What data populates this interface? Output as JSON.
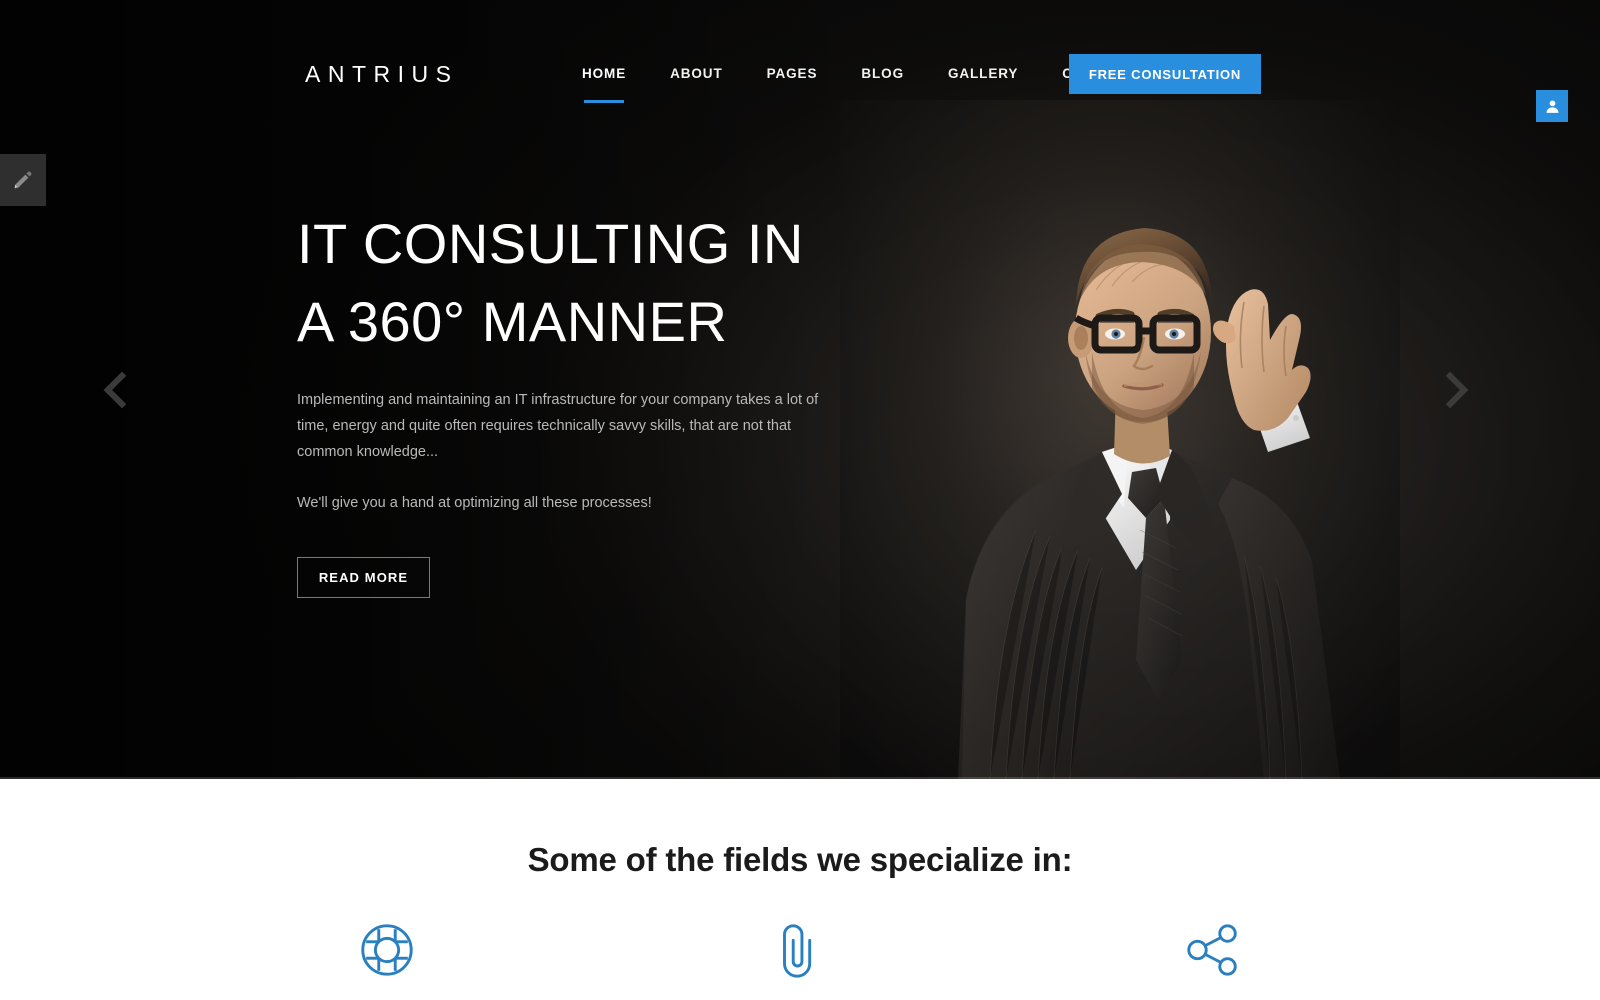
{
  "brand": {
    "name": "ANTRIUS",
    "accent_color": "#2a8ede"
  },
  "header": {
    "nav": [
      {
        "label": "HOME",
        "active": true
      },
      {
        "label": "ABOUT",
        "active": false
      },
      {
        "label": "PAGES",
        "active": false
      },
      {
        "label": "BLOG",
        "active": false
      },
      {
        "label": "GALLERY",
        "active": false
      },
      {
        "label": "CONTACTS",
        "active": false
      }
    ],
    "cta_label": "FREE CONSULTATION"
  },
  "hero": {
    "title": "IT CONSULTING IN\nA 360° MANNER",
    "description": "Implementing and maintaining an IT infrastructure for your company takes a lot of time, energy and quite often requires technically savvy skills, that are not that common knowledge...",
    "subtext": "We'll give you a hand at optimizing all these processes!",
    "button_label": "READ MORE",
    "prev_icon": "chevron-left-icon",
    "next_icon": "chevron-right-icon",
    "photo_alt": "businessman-in-suit-adjusting-glasses"
  },
  "side_tabs": {
    "edit_icon": "pencil-icon",
    "account_icon": "user-icon"
  },
  "specialize": {
    "title": "Some of the fields we specialize in:",
    "features": [
      {
        "icon": "lifebuoy-icon",
        "color": "#2a7fc1"
      },
      {
        "icon": "paperclip-icon",
        "color": "#2a7fc1"
      },
      {
        "icon": "share-network-icon",
        "color": "#2a7fc1"
      }
    ]
  }
}
